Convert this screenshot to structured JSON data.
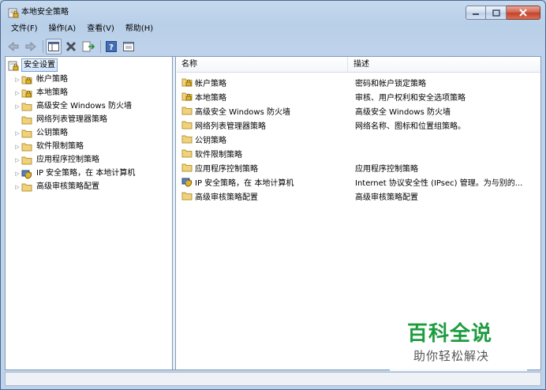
{
  "window": {
    "title": "本地安全策略"
  },
  "menu": [
    "文件(F)",
    "操作(A)",
    "查看(V)",
    "帮助(H)"
  ],
  "toolbar": {
    "buttons": [
      "back-icon",
      "forward-icon",
      "show-hide-console-tree-icon",
      "delete-icon",
      "export-list-icon",
      "help-icon",
      "properties-icon"
    ]
  },
  "tree": {
    "root": "安全设置",
    "items": [
      {
        "label": "帐户策略",
        "icon": "folder-lock"
      },
      {
        "label": "本地策略",
        "icon": "folder-lock"
      },
      {
        "label": "高级安全 Windows 防火墙",
        "icon": "folder"
      },
      {
        "label": "网络列表管理器策略",
        "icon": "folder"
      },
      {
        "label": "公钥策略",
        "icon": "folder"
      },
      {
        "label": "软件限制策略",
        "icon": "folder"
      },
      {
        "label": "应用程序控制策略",
        "icon": "folder"
      },
      {
        "label": "IP 安全策略，在 本地计算机",
        "icon": "shield"
      },
      {
        "label": "高级审核策略配置",
        "icon": "folder"
      }
    ]
  },
  "list": {
    "col_name": "名称",
    "col_desc": "描述",
    "rows": [
      {
        "name": "帐户策略",
        "desc": "密码和帐户锁定策略"
      },
      {
        "name": "本地策略",
        "desc": "审核、用户权利和安全选项策略"
      },
      {
        "name": "高级安全 Windows 防火墙",
        "desc": "高级安全 Windows 防火墙"
      },
      {
        "name": "网络列表管理器策略",
        "desc": "网络名称、图标和位置组策略。"
      },
      {
        "name": "公钥策略",
        "desc": ""
      },
      {
        "name": "软件限制策略",
        "desc": ""
      },
      {
        "name": "应用程序控制策略",
        "desc": "应用程序控制策略"
      },
      {
        "name": "IP 安全策略，在 本地计算机",
        "desc": "Internet 协议安全性 (IPsec) 管理。为与别的..."
      },
      {
        "name": "高级审核策略配置",
        "desc": "高级审核策略配置"
      }
    ]
  },
  "watermark": {
    "title": "百科全说",
    "subtitle": "助你轻松解决"
  }
}
